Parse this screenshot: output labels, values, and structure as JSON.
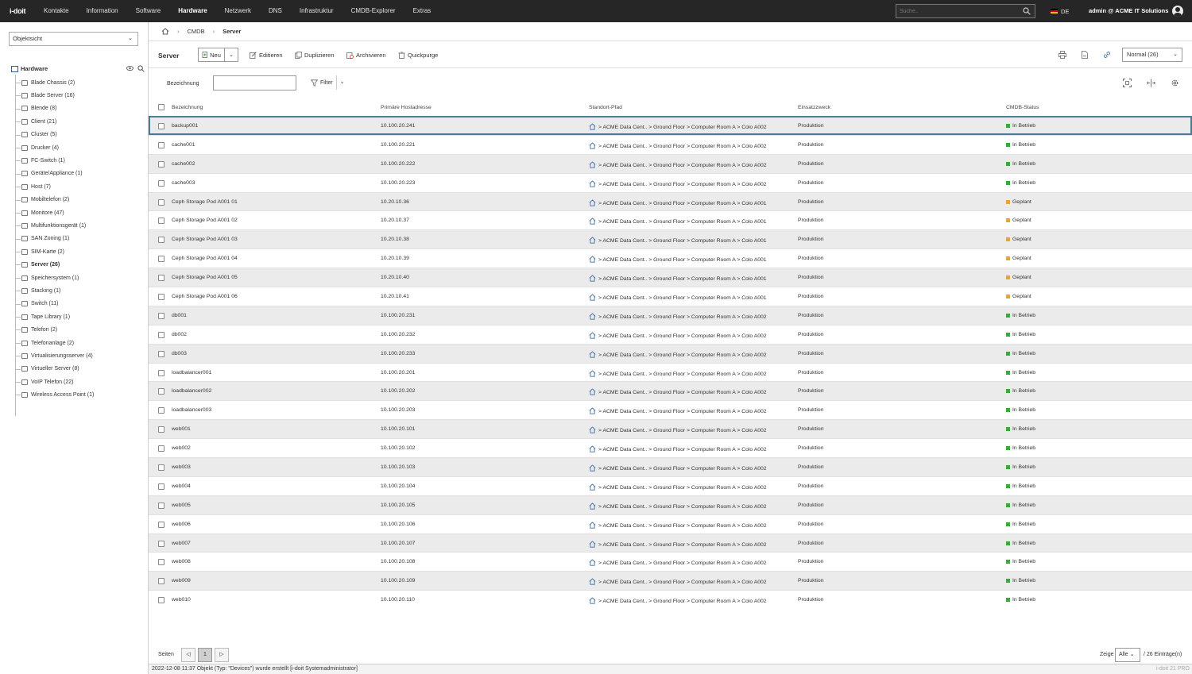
{
  "app": {
    "logo": "i-doit",
    "nav": [
      "Kontakte",
      "Information",
      "Software",
      "Hardware",
      "Netzwerk",
      "DNS",
      "Infrastruktur",
      "CMDB-Explorer",
      "Extras"
    ],
    "active_nav": "Hardware",
    "search_placeholder": "Suche..",
    "language": "DE",
    "user": "admin @ ACME IT Solutions"
  },
  "sidebar": {
    "view_select": "Objektsicht",
    "root": "Hardware",
    "items": [
      {
        "label": "Blade Chassis (2)"
      },
      {
        "label": "Blade Server (16)"
      },
      {
        "label": "Blende (8)"
      },
      {
        "label": "Client (21)"
      },
      {
        "label": "Cluster (5)"
      },
      {
        "label": "Drucker (4)"
      },
      {
        "label": "FC-Switch (1)"
      },
      {
        "label": "Geräte/Appliance (1)"
      },
      {
        "label": "Host (7)"
      },
      {
        "label": "Mobiltelefon (2)"
      },
      {
        "label": "Monitore (47)"
      },
      {
        "label": "Multifunktionsgerät (1)"
      },
      {
        "label": "SAN Zoning (1)"
      },
      {
        "label": "SIM-Karte (2)"
      },
      {
        "label": "Server (26)",
        "active": true
      },
      {
        "label": "Speichersystem (1)"
      },
      {
        "label": "Stacking (1)"
      },
      {
        "label": "Switch (11)"
      },
      {
        "label": "Tape Library (1)"
      },
      {
        "label": "Telefon (2)"
      },
      {
        "label": "Telefonanlage (2)"
      },
      {
        "label": "Virtualisierungsserver (4)"
      },
      {
        "label": "Virtueller Server (8)"
      },
      {
        "label": "VoIP Telefon (22)"
      },
      {
        "label": "Wireless Access Point (1)"
      }
    ]
  },
  "breadcrumb": {
    "level1": "CMDB",
    "current": "Server"
  },
  "toolbar": {
    "title": "Server",
    "new_label": "Neu",
    "edit_label": "Editieren",
    "duplicate_label": "Duplizieren",
    "archive_label": "Archivieren",
    "purge_label": "Quickpurge",
    "view_select": "Normal (26)"
  },
  "filter": {
    "label": "Bezeichnung",
    "filter_label": "Filter"
  },
  "table": {
    "headers": {
      "name": "Bezeichnung",
      "ip": "Primäre Hostadresse",
      "location": "Standort-Pfad",
      "purpose": "Einsatzzweck",
      "status": "CMDB-Status"
    },
    "status_colors": {
      "In Betrieb": "#3aa93a",
      "Geplant": "#e8a33c"
    },
    "rows": [
      {
        "name": "backup001",
        "ip": "10.100.20.241",
        "location": "> ACME Data Cent.. > Ground Floor > Computer Room A > Colo A002",
        "purpose": "Produktion",
        "status": "In Betrieb"
      },
      {
        "name": "cache001",
        "ip": "10.100.20.221",
        "location": "> ACME Data Cent.. > Ground Floor > Computer Room A > Colo A002",
        "purpose": "Produktion",
        "status": "In Betrieb"
      },
      {
        "name": "cache002",
        "ip": "10.100.20.222",
        "location": "> ACME Data Cent.. > Ground Floor > Computer Room A > Colo A002",
        "purpose": "Produktion",
        "status": "In Betrieb"
      },
      {
        "name": "cache003",
        "ip": "10.100.20.223",
        "location": "> ACME Data Cent.. > Ground Floor > Computer Room A > Colo A002",
        "purpose": "Produktion",
        "status": "In Betrieb"
      },
      {
        "name": "Ceph Storage Pod A001 01",
        "ip": "10.20.10.36",
        "location": "> ACME Data Cent.. > Ground Floor > Computer Room A > Colo A001",
        "purpose": "Produktion",
        "status": "Geplant"
      },
      {
        "name": "Ceph Storage Pod A001 02",
        "ip": "10.20.10.37",
        "location": "> ACME Data Cent.. > Ground Floor > Computer Room A > Colo A001",
        "purpose": "Produktion",
        "status": "Geplant"
      },
      {
        "name": "Ceph Storage Pod A001 03",
        "ip": "10.20.10.38",
        "location": "> ACME Data Cent.. > Ground Floor > Computer Room A > Colo A001",
        "purpose": "Produktion",
        "status": "Geplant"
      },
      {
        "name": "Ceph Storage Pod A001 04",
        "ip": "10.20.10.39",
        "location": "> ACME Data Cent.. > Ground Floor > Computer Room A > Colo A001",
        "purpose": "Produktion",
        "status": "Geplant"
      },
      {
        "name": "Ceph Storage Pod A001 05",
        "ip": "10.20.10.40",
        "location": "> ACME Data Cent.. > Ground Floor > Computer Room A > Colo A001",
        "purpose": "Produktion",
        "status": "Geplant"
      },
      {
        "name": "Ceph Storage Pod A001 06",
        "ip": "10.20.10.41",
        "location": "> ACME Data Cent.. > Ground Floor > Computer Room A > Colo A001",
        "purpose": "Produktion",
        "status": "Geplant"
      },
      {
        "name": "db001",
        "ip": "10.100.20.231",
        "location": "> ACME Data Cent.. > Ground Floor > Computer Room A > Colo A002",
        "purpose": "Produktion",
        "status": "In Betrieb"
      },
      {
        "name": "db002",
        "ip": "10.100.20.232",
        "location": "> ACME Data Cent.. > Ground Floor > Computer Room A > Colo A002",
        "purpose": "Produktion",
        "status": "In Betrieb"
      },
      {
        "name": "db003",
        "ip": "10.100.20.233",
        "location": "> ACME Data Cent.. > Ground Floor > Computer Room A > Colo A002",
        "purpose": "Produktion",
        "status": "In Betrieb"
      },
      {
        "name": "loadbalancer001",
        "ip": "10.100.20.201",
        "location": "> ACME Data Cent.. > Ground Floor > Computer Room A > Colo A002",
        "purpose": "Produktion",
        "status": "In Betrieb"
      },
      {
        "name": "loadbalancer002",
        "ip": "10.100.20.202",
        "location": "> ACME Data Cent.. > Ground Floor > Computer Room A > Colo A002",
        "purpose": "Produktion",
        "status": "In Betrieb"
      },
      {
        "name": "loadbalancer003",
        "ip": "10.100.20.203",
        "location": "> ACME Data Cent.. > Ground Floor > Computer Room A > Colo A002",
        "purpose": "Produktion",
        "status": "In Betrieb"
      },
      {
        "name": "web001",
        "ip": "10.100.20.101",
        "location": "> ACME Data Cent.. > Ground Floor > Computer Room A > Colo A002",
        "purpose": "Produktion",
        "status": "In Betrieb"
      },
      {
        "name": "web002",
        "ip": "10.100.20.102",
        "location": "> ACME Data Cent.. > Ground Floor > Computer Room A > Colo A002",
        "purpose": "Produktion",
        "status": "In Betrieb"
      },
      {
        "name": "web003",
        "ip": "10.100.20.103",
        "location": "> ACME Data Cent.. > Ground Floor > Computer Room A > Colo A002",
        "purpose": "Produktion",
        "status": "In Betrieb"
      },
      {
        "name": "web004",
        "ip": "10.100.20.104",
        "location": "> ACME Data Cent.. > Ground Floor > Computer Room A > Colo A002",
        "purpose": "Produktion",
        "status": "In Betrieb"
      },
      {
        "name": "web005",
        "ip": "10.100.20.105",
        "location": "> ACME Data Cent.. > Ground Floor > Computer Room A > Colo A002",
        "purpose": "Produktion",
        "status": "In Betrieb"
      },
      {
        "name": "web006",
        "ip": "10.100.20.106",
        "location": "> ACME Data Cent.. > Ground Floor > Computer Room A > Colo A002",
        "purpose": "Produktion",
        "status": "In Betrieb"
      },
      {
        "name": "web007",
        "ip": "10.100.20.107",
        "location": "> ACME Data Cent.. > Ground Floor > Computer Room A > Colo A002",
        "purpose": "Produktion",
        "status": "In Betrieb"
      },
      {
        "name": "web008",
        "ip": "10.100.20.108",
        "location": "> ACME Data Cent.. > Ground Floor > Computer Room A > Colo A002",
        "purpose": "Produktion",
        "status": "In Betrieb"
      },
      {
        "name": "web009",
        "ip": "10.100.20.109",
        "location": "> ACME Data Cent.. > Ground Floor > Computer Room A > Colo A002",
        "purpose": "Produktion",
        "status": "In Betrieb"
      },
      {
        "name": "web010",
        "ip": "10.100.20.110",
        "location": "> ACME Data Cent.. > Ground Floor > Computer Room A > Colo A002",
        "purpose": "Produktion",
        "status": "In Betrieb"
      }
    ]
  },
  "pager": {
    "label": "Seiten",
    "current_page": "1",
    "show_label": "Zeige",
    "show_value": "Alle",
    "entries": "/ 26 Einträge(n)"
  },
  "statusbar": {
    "message": "2022-12-08 11:37 Objekt (Typ: \"Devices\") wurde erstellt [i-doit Systemadministrator]",
    "version": "i-doit 21 PRO"
  }
}
